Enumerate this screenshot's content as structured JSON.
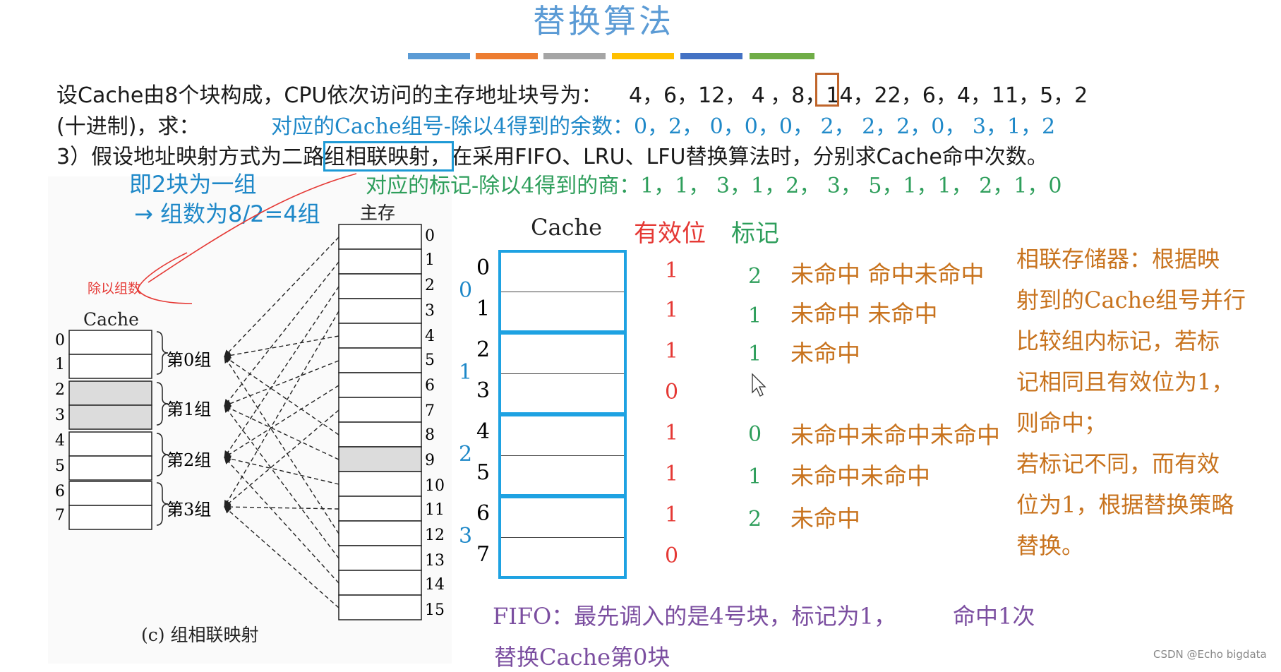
{
  "title": "替换算法",
  "color_bars": [
    "#5b9bd5",
    "#ed7d31",
    "#a5a5a5",
    "#ffc000",
    "#4472c4",
    "#70ad47"
  ],
  "problem": {
    "line1_prefix": "设Cache由8个块构成，CPU依次访问的主存地址块号为：",
    "line1_seq_a": "4，6，12，",
    "line1_boxed": "4",
    "line1_seq_b": "，8，14，22，6，4，11，5，2",
    "line2_prefix": "(十进制)，求：",
    "line2_note": "对应的Cache组号-除以4得到的余数：0，2，  0，0，0，  2，  2，2，0，  3，1，2",
    "line3_a": "3）假设地址映射方式为",
    "line3_boxed": "二路组相联",
    "line3_b": "映射，在采用FIFO、LRU、LFU替换算法时，分别求Cache命中次数。"
  },
  "annotations": {
    "group_size": "即2块为一组",
    "group_count": "→ 组数为8/2=4组",
    "tag_note": "对应的标记-除以4得到的商：1，1，  3，1，2，  3，  5，1，1，  2，1，0",
    "divide_by_groups": "除以组数"
  },
  "left_figure": {
    "main_memory_label": "主存",
    "cache_label": "Cache",
    "caption": "(c) 组相联映射",
    "cache_rows": [
      "0",
      "1",
      "2",
      "3",
      "4",
      "5",
      "6",
      "7"
    ],
    "group_labels": [
      "第0组",
      "第1组",
      "第2组",
      "第3组"
    ],
    "memory_rows": [
      "0",
      "1",
      "2",
      "3",
      "4",
      "5",
      "6",
      "7",
      "8",
      "9",
      "10",
      "11",
      "12",
      "13",
      "14",
      "15"
    ]
  },
  "right_table": {
    "cache_header": "Cache",
    "valid_header": "有效位",
    "tag_header": "标记",
    "group_numbers": [
      "0",
      "1",
      "2",
      "3"
    ],
    "row_numbers": [
      "0",
      "1",
      "2",
      "3",
      "4",
      "5",
      "6",
      "7"
    ],
    "valid_bits": [
      "1",
      "1",
      "1",
      "0",
      "1",
      "1",
      "1",
      "0"
    ],
    "tags": [
      "2",
      "1",
      "1",
      "",
      "0",
      "1",
      "2",
      ""
    ],
    "hit_status": [
      "未命中 命中未命中",
      "未命中 未命中",
      "未命中",
      "",
      "未命中未命中未命中",
      "未命中未命中",
      "未命中",
      ""
    ]
  },
  "explanation": {
    "lines": [
      "相联存储器：根据映",
      "射到的Cache组号并行",
      "比较组内标记，若标",
      "记相同且有效位为1，",
      "则命中；",
      "若标记不同，而有效",
      "位为1，根据替换策略",
      "替换。"
    ]
  },
  "fifo": {
    "line1": "FIFO：最先调入的是4号块，标记为1，",
    "hit_count": "命中1次",
    "line2": "替换Cache第0块"
  },
  "watermark": "CSDN @Echo bigdata"
}
